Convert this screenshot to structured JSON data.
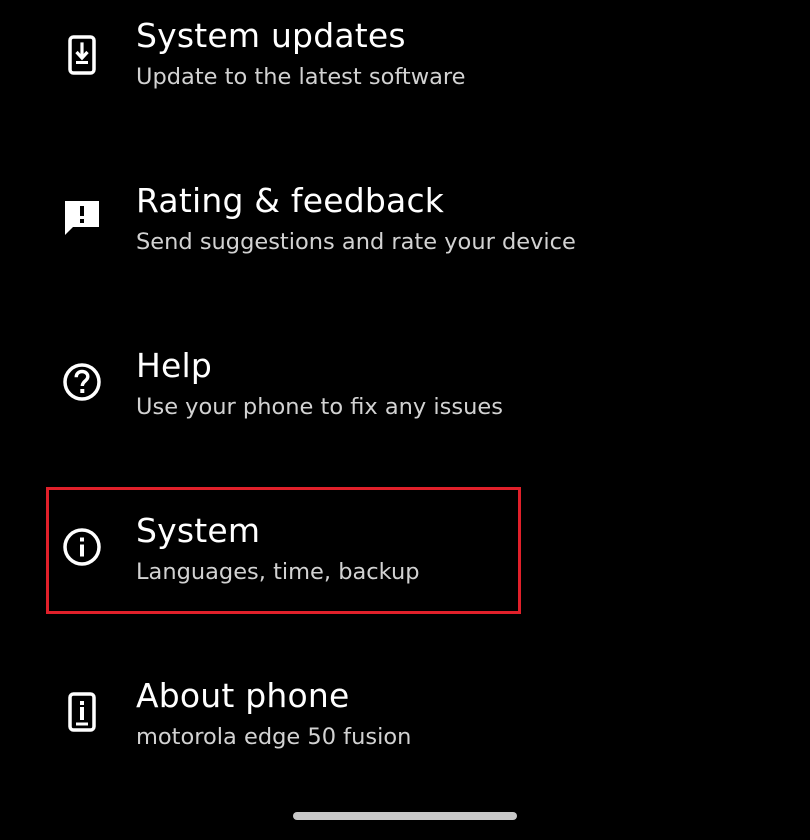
{
  "settings": {
    "items": [
      {
        "icon": "system-update-icon",
        "title": "System updates",
        "subtitle": "Update to the latest software"
      },
      {
        "icon": "feedback-icon",
        "title": "Rating & feedback",
        "subtitle": "Send suggestions and rate your device"
      },
      {
        "icon": "help-icon",
        "title": "Help",
        "subtitle": "Use your phone to fix any issues"
      },
      {
        "icon": "info-icon",
        "title": "System",
        "subtitle": "Languages, time, backup"
      },
      {
        "icon": "phone-info-icon",
        "title": "About phone",
        "subtitle": "motorola edge 50 fusion"
      }
    ]
  },
  "colors": {
    "background": "#000000",
    "title_text": "#ffffff",
    "subtitle_text": "#d2d2d2",
    "highlight": "#e0202a"
  }
}
